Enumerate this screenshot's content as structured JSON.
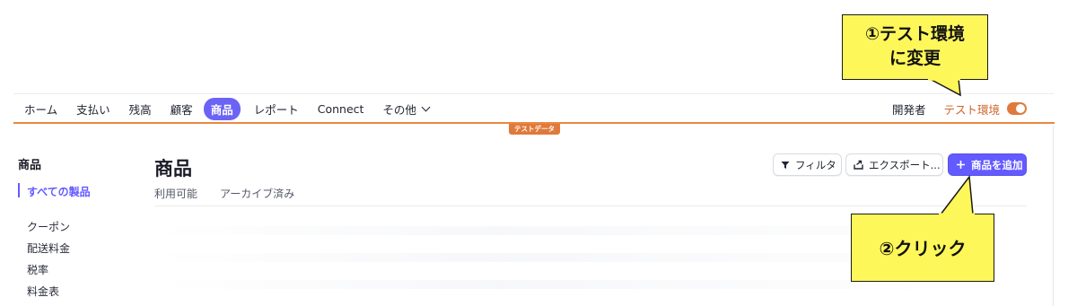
{
  "nav": {
    "items": [
      "ホーム",
      "支払い",
      "残高",
      "顧客",
      "商品",
      "レポート",
      "Connect"
    ],
    "active_index": 4,
    "more_label": "その他",
    "developers_label": "開発者",
    "test_mode_label": "テスト環境",
    "test_mode_on": true,
    "test_data_badge": "テストデータ"
  },
  "sidebar": {
    "title": "商品",
    "items": [
      {
        "label": "すべての製品",
        "active": true
      },
      {
        "label": "クーポン",
        "active": false
      },
      {
        "label": "配送料金",
        "active": false
      },
      {
        "label": "税率",
        "active": false
      },
      {
        "label": "料金表",
        "active": false
      }
    ]
  },
  "main": {
    "title": "商品",
    "tabs": [
      "利用可能",
      "アーカイブ済み"
    ],
    "buttons": {
      "filter": "フィルタ",
      "export": "エクスポート...",
      "add_product": "商品を追加"
    }
  },
  "annotations": {
    "step1_line1": "①テスト環境",
    "step1_line2": "に変更",
    "step2": "②クリック"
  },
  "colors": {
    "accent": "#635bff",
    "test_mode": "#e07a3c",
    "callout": "#fef75a"
  },
  "icons": {
    "filter": "filter-funnel-icon",
    "export": "export-upload-icon",
    "add": "plus-icon",
    "more": "chevron-down-icon"
  }
}
